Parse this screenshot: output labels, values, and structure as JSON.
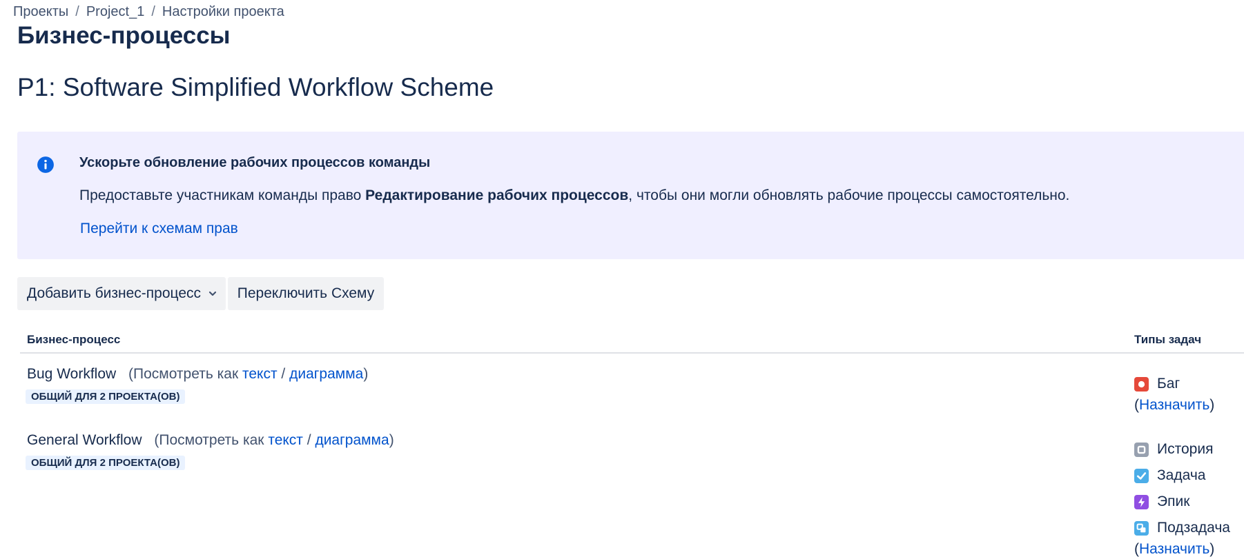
{
  "breadcrumbs": [
    {
      "label": "Проекты"
    },
    {
      "label": "Project_1"
    },
    {
      "label": "Настройки проекта"
    }
  ],
  "breadcrumb_separator": "/",
  "page_title": "Бизнес-процессы",
  "scheme_name": "P1: Software Simplified Workflow Scheme",
  "banner": {
    "icon": "info-icon",
    "title": "Ускорьте обновление рабочих процессов команды",
    "body_prefix": "Предоставьте участникам команды право ",
    "body_bold": "Редактирование рабочих процессов",
    "body_suffix": ", чтобы они могли обновлять рабочие процессы самостоятельно.",
    "link": "Перейти к схемам прав",
    "background_color": "#f0efff"
  },
  "toolbar": {
    "add_label": "Добавить бизнес-процесс",
    "switch_label": "Переключить Схему"
  },
  "table": {
    "headers": {
      "workflow": "Бизнес-процесс",
      "issue_types": "Типы задач"
    },
    "rows": [
      {
        "name": "Bug Workflow",
        "view_prefix": "(Посмотреть как ",
        "view_text": "текст",
        "view_sep": " / ",
        "view_diagram": "диаграмма",
        "view_suffix": ")",
        "lozenge": "ОБЩИЙ ДЛЯ 2 ПРОЕКТА(ОВ)",
        "issue_types": [
          {
            "label": "Баг",
            "icon": "bug-icon",
            "color": "#e5493a"
          }
        ],
        "assign_open": "(",
        "assign_link": "Назначить",
        "assign_close": ")"
      },
      {
        "name": "General Workflow",
        "view_prefix": "(Посмотреть как ",
        "view_text": "текст",
        "view_sep": " / ",
        "view_diagram": "диаграмма",
        "view_suffix": ")",
        "lozenge": "ОБЩИЙ ДЛЯ 2 ПРОЕКТА(ОВ)",
        "issue_types": [
          {
            "label": "История",
            "icon": "story-icon",
            "color": "#97a0af"
          },
          {
            "label": "Задача",
            "icon": "task-icon",
            "color": "#4bade8"
          },
          {
            "label": "Эпик",
            "icon": "epic-icon",
            "color": "#904ee2"
          },
          {
            "label": "Подзадача",
            "icon": "subtask-icon",
            "color": "#4bade8"
          }
        ],
        "assign_open": "(",
        "assign_link": "Назначить",
        "assign_close": ")"
      }
    ]
  },
  "colors": {
    "link": "#0052cc",
    "text": "#172b4d",
    "lozenge_bg": "#e9f2ff",
    "info_icon": "#0c66e4"
  }
}
